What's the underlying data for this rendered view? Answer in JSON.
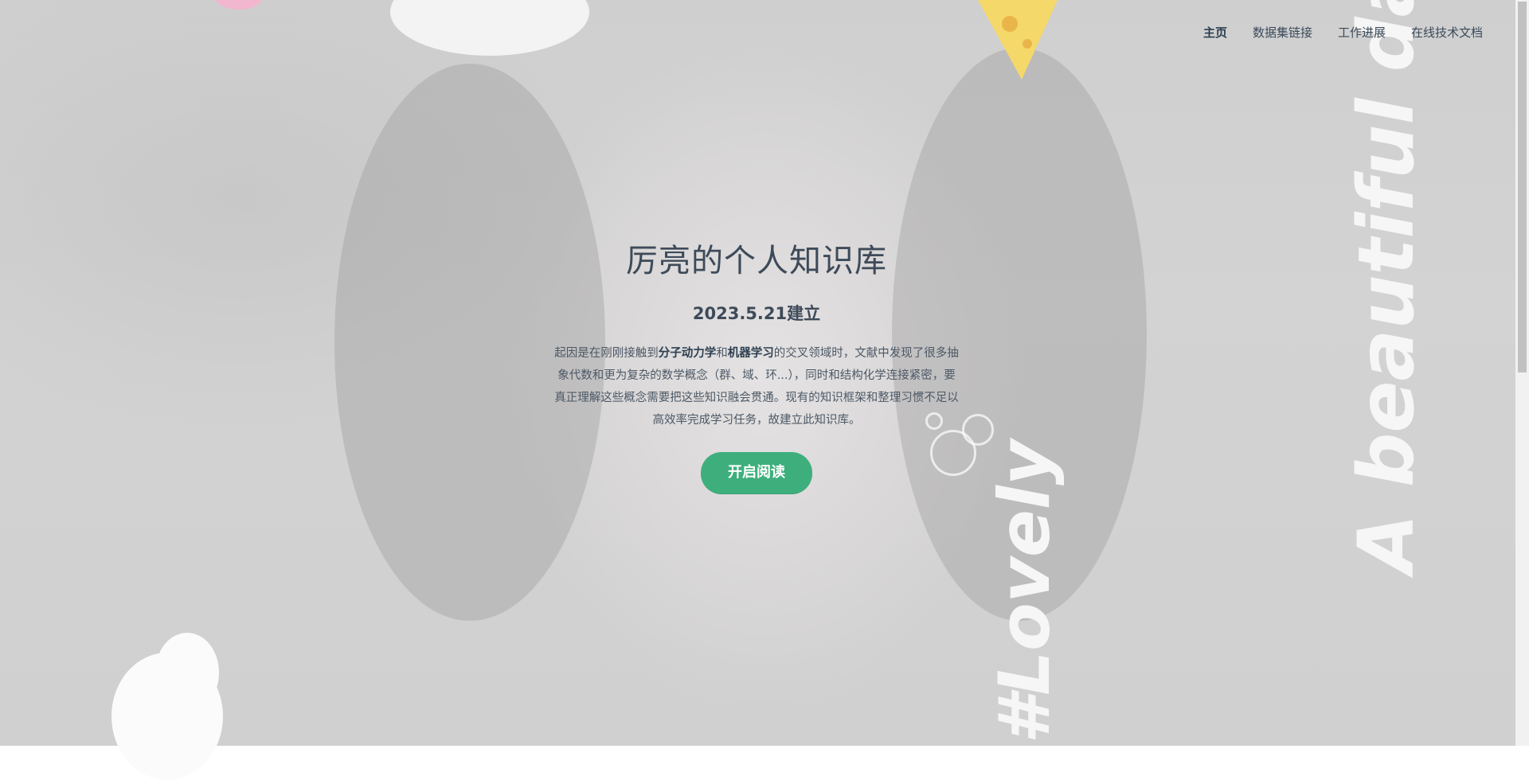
{
  "nav": {
    "items": [
      {
        "label": "主页",
        "active": true
      },
      {
        "label": "数据集链接",
        "active": false
      },
      {
        "label": "工作进展",
        "active": false
      },
      {
        "label": "在线技术文档",
        "active": false
      }
    ]
  },
  "hero": {
    "title": "厉亮的个人知识库",
    "date_prefix": "2023.5.21",
    "date_suffix": "建立",
    "desc": {
      "p1": "起因是在刚刚接触到",
      "b1": "分子动力学",
      "p2": "和",
      "b2": "机器学习",
      "p3": "的交叉领域时，文献中发现了很多抽象代数和更为复杂的数学概念（群、域、环...），同时和结构化学连接紧密，要真正理解这些概念需要把这些知识融会贯通。现有的知识框架和整理习惯不足以高效率完成学习任务，故建立此知识库。"
    },
    "button_label": "开启阅读"
  },
  "background": {
    "deco_text_1": "A beautiful day",
    "deco_text_2": "#Lovely",
    "accent_color": "#3eaf7c"
  }
}
